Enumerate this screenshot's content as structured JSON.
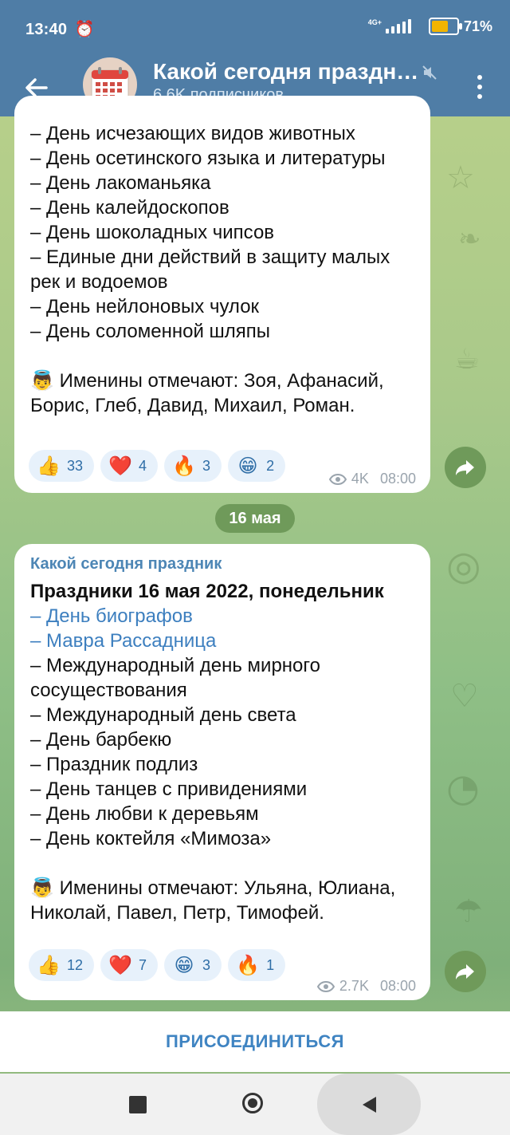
{
  "status_bar": {
    "time": "13:40",
    "network": "4G+",
    "battery": "71%",
    "battery_level": 0.71
  },
  "header": {
    "title": "Какой сегодня праздн…",
    "subtitle": "6.6K подписчиков"
  },
  "messages": [
    {
      "lines": [
        "– День исчезающих видов животных",
        "– День осетинского языка и литературы",
        "– День лакоманьяка",
        "– День калейдоскопов",
        "– День шоколадных чипсов",
        "– Единые дни действий в защиту малых рек и водоемов",
        "– День нейлоновых чулок",
        "– День соломенной шляпы"
      ],
      "namedays": "Именины отмечают: Зоя, Афанасий, Борис, Глеб, Давид, Михаил, Роман.",
      "reactions": [
        {
          "emoji": "👍",
          "count": "33"
        },
        {
          "emoji": "❤️",
          "count": "4"
        },
        {
          "emoji": "🔥",
          "count": "3"
        },
        {
          "emoji": "😁",
          "count": "2"
        }
      ],
      "views": "4K",
      "time": "08:00"
    },
    {
      "channel": "Какой сегодня праздник",
      "heading": "Праздники 16 мая 2022, понедельник",
      "links": [
        "– День биографов",
        "– Мавра Рассадница"
      ],
      "lines": [
        "– Международный день мирного сосуществования",
        "– Международный день света",
        "– День барбекю",
        "– Праздник подлиз",
        "– День танцев с привидениями",
        "– День любви к деревьям",
        "– День коктейля «Мимоза»"
      ],
      "namedays": "Именины отмечают: Ульяна, Юлиана, Николай, Павел, Петр, Тимофей.",
      "reactions": [
        {
          "emoji": "👍",
          "count": "12"
        },
        {
          "emoji": "❤️",
          "count": "7"
        },
        {
          "emoji": "😁",
          "count": "3"
        },
        {
          "emoji": "🔥",
          "count": "1"
        }
      ],
      "views": "2.7K",
      "time": "08:00"
    }
  ],
  "date_separator": "16 мая",
  "join_button": "ПРИСОЕДИНИТЬСЯ",
  "colors": {
    "header": "#4f7da6",
    "link": "#3d7fbf",
    "reaction_bg": "#e7f1fb",
    "date_chip": "#6f9a5a"
  },
  "icons": [
    "back-arrow-icon",
    "calendar-icon",
    "mute-icon",
    "more-vert-icon",
    "forward-icon",
    "eye-icon",
    "alarm-icon",
    "square-nav-icon",
    "circle-nav-icon",
    "back-nav-icon"
  ]
}
